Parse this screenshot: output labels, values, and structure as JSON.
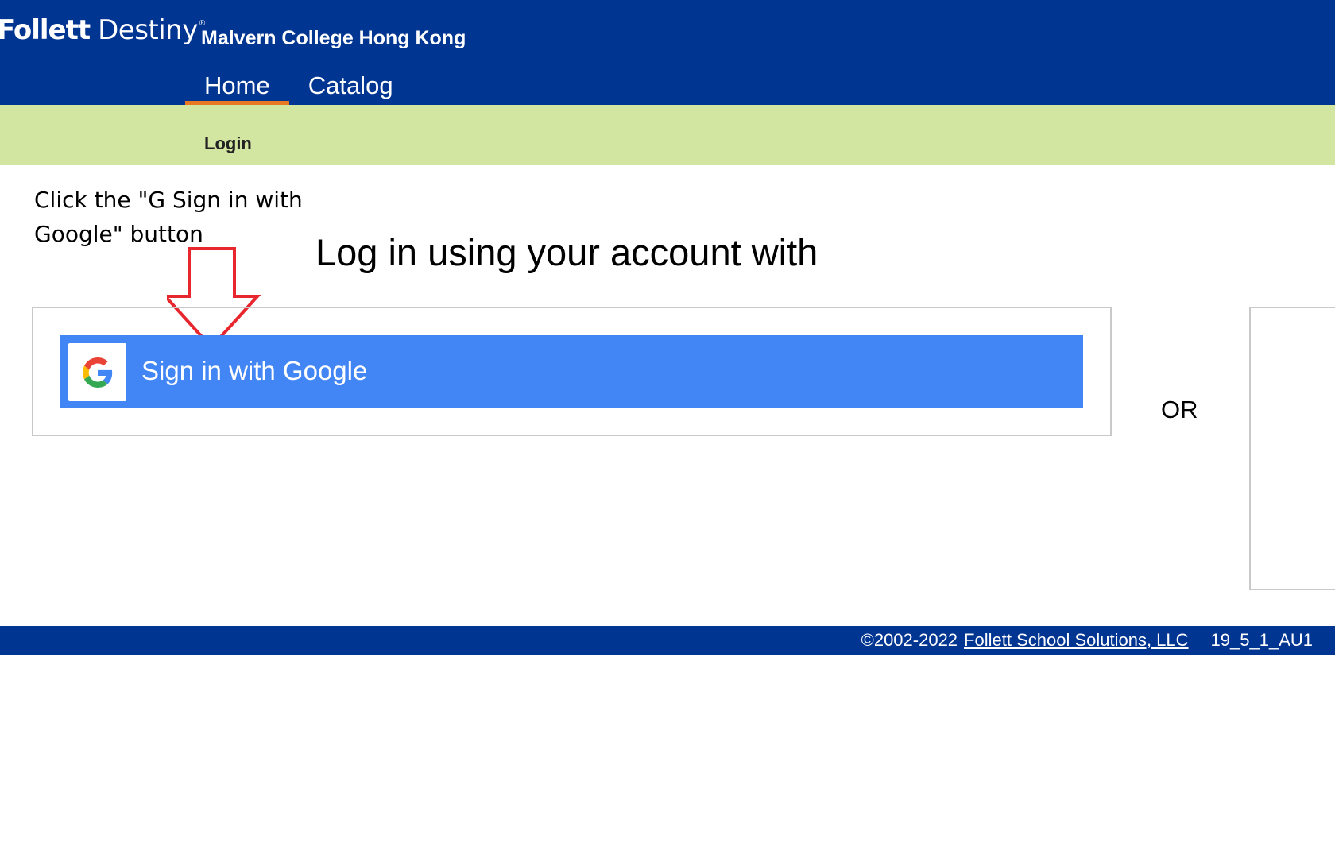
{
  "header": {
    "logo_brand": "Follett",
    "logo_product": "Destiny",
    "logo_reg": "®",
    "school_name": "Malvern College Hong Kong",
    "tabs": [
      {
        "label": "Home",
        "active": true
      },
      {
        "label": "Catalog",
        "active": false
      }
    ]
  },
  "subnav": {
    "current": "Login"
  },
  "annotation": {
    "instruction": "Click the \"G Sign in with Google\" button",
    "arrow_color": "#e8262d"
  },
  "main": {
    "heading": "Log in using your account with",
    "google_button": {
      "icon": "google-g-icon",
      "label": "Sign in with Google"
    },
    "or_label": "OR"
  },
  "footer": {
    "copyright": "©2002-2022",
    "company_link": "Follett School Solutions, LLC",
    "version": "19_5_1_AU1"
  },
  "colors": {
    "header_bg": "#003591",
    "active_tab_underline": "#e87722",
    "subbar_bg": "#d2e5a1",
    "google_button_bg": "#4285f4"
  }
}
